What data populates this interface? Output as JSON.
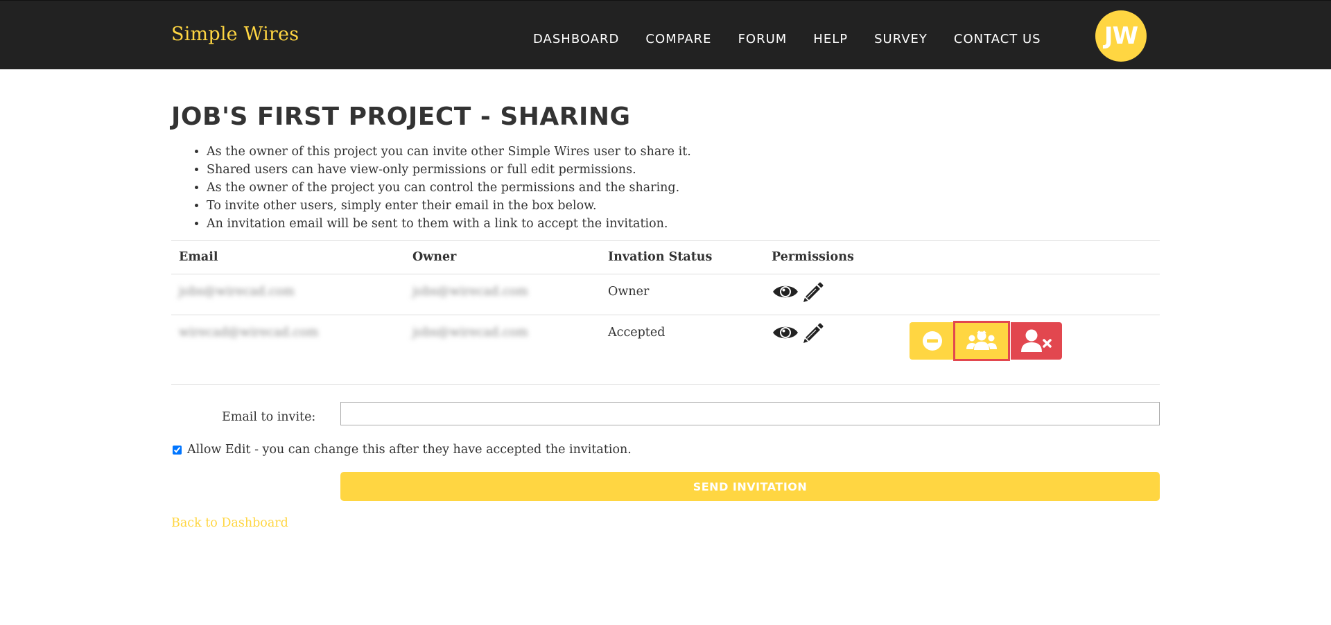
{
  "brand": {
    "name": "Simple Wires",
    "accent_color": "#ffd642"
  },
  "nav": {
    "items": [
      {
        "label": "DASHBOARD"
      },
      {
        "label": "COMPARE"
      },
      {
        "label": "FORUM"
      },
      {
        "label": "HELP"
      },
      {
        "label": "SURVEY"
      },
      {
        "label": "CONTACT US"
      }
    ],
    "avatar_initials": "JW"
  },
  "page": {
    "title": "JOB'S FIRST PROJECT - SHARING",
    "bullets": [
      "As the owner of this project you can invite other Simple Wires user to share it.",
      "Shared users can have view-only permissions or full edit permissions.",
      "As the owner of the project you can control the permissions and the sharing.",
      "To invite other users, simply enter their email in the box below.",
      "An invitation email will be sent to them with a link to accept the invitation."
    ]
  },
  "table": {
    "headers": {
      "email": "Email",
      "owner": "Owner",
      "status": "Invation Status",
      "permissions": "Permissions"
    },
    "rows": [
      {
        "email": "jobs@wirecad.com",
        "owner": "jobs@wirecad.com",
        "status": "Owner",
        "perm_icons": [
          "eye-icon",
          "pencil-icon"
        ]
      },
      {
        "email": "wirecad@wirecad.com",
        "owner": "jobs@wirecad.com",
        "status": "Accepted",
        "perm_icons": [
          "eye-icon",
          "pencil-icon"
        ],
        "actions": [
          "minus-circle-icon",
          "users-group-icon",
          "user-remove-icon"
        ]
      }
    ]
  },
  "form": {
    "invite_label": "Email to invite:",
    "invite_value": "",
    "allow_edit_checked": true,
    "allow_edit_label": "Allow Edit - you can change this after they have accepted the invitation.",
    "send_label": "SEND INVITATION"
  },
  "back_link": "Back to Dashboard",
  "colors": {
    "navbar": "#222222",
    "accent": "#ffd642",
    "danger": "#e2474f"
  }
}
